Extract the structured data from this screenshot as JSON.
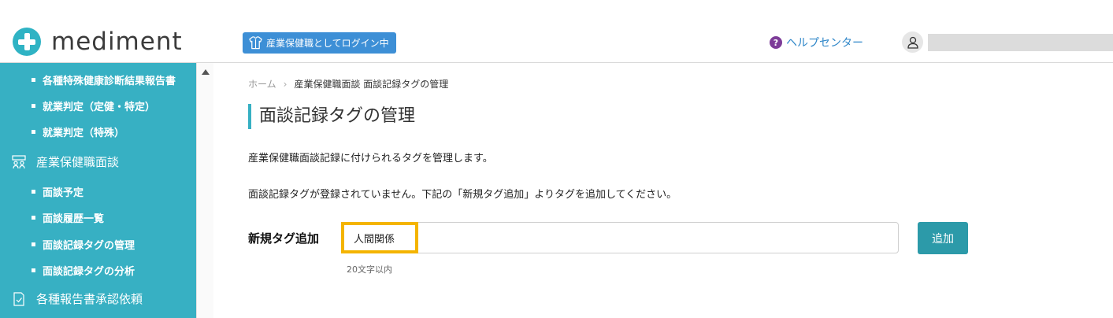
{
  "header": {
    "logo_text": "mediment",
    "login_badge": "産業保健職としてログイン中",
    "help_label": "ヘルプセンター",
    "help_icon": "?"
  },
  "sidebar": {
    "sub_items_top": [
      {
        "label": "各種特殊健康診断結果報告書"
      },
      {
        "label": "就業判定（定健・特定）"
      },
      {
        "label": "就業判定（特殊）"
      }
    ],
    "section_interview": "産業保健職面談",
    "interview_items": [
      {
        "label": "面談予定"
      },
      {
        "label": "面談履歴一覧"
      },
      {
        "label": "面談記録タグの管理"
      },
      {
        "label": "面談記録タグの分析"
      }
    ],
    "section_reports": "各種報告書承認依頼"
  },
  "breadcrumb": {
    "home": "ホーム",
    "separator": "›",
    "current": "産業保健職面談 面談記録タグの管理"
  },
  "page": {
    "title": "面談記録タグの管理",
    "description": "産業保健職面談記録に付けられるタグを管理します。",
    "empty_message": "面談記録タグが登録されていません。下記の「新規タグ追加」よりタグを追加してください。"
  },
  "form": {
    "label": "新規タグ追加",
    "value": "人間関係",
    "hint": "20文字以内",
    "add_button": "追加"
  },
  "colors": {
    "accent": "#37b0c3",
    "button": "#2c9aa9",
    "badge": "#3d8fd6",
    "highlight": "#f4b400"
  }
}
